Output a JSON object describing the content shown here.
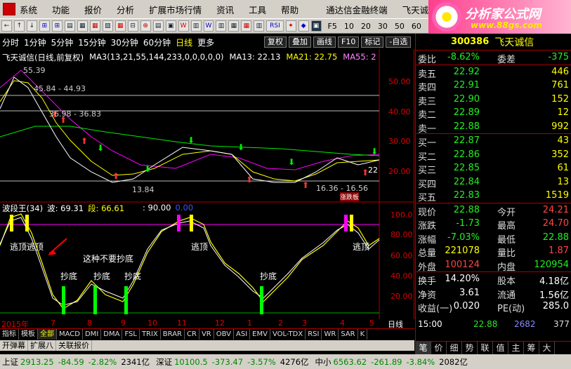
{
  "menu": {
    "items": [
      "系统",
      "功能",
      "报价",
      "分析",
      "扩展市场行情",
      "资讯",
      "工具",
      "帮助"
    ],
    "broker": "通达信金融终端",
    "stock_name": "飞天诚信",
    "trade_label": "行"
  },
  "logo": {
    "title": "分析家公式网",
    "url": "www.88gs.com"
  },
  "toolbar": {
    "buttons": [
      "←",
      "↑",
      "↓",
      "⊞",
      "⊞",
      "▤",
      "▦",
      "▦",
      "▧",
      "▦",
      "⊟",
      "⊕",
      "▤",
      "▣",
      "W",
      "▥",
      "W",
      "▥",
      "▦",
      "▦",
      "▥",
      "RSI",
      "✦",
      "◆",
      "▣"
    ],
    "nums": [
      "F5",
      "10",
      "20",
      "30",
      "50",
      "60"
    ]
  },
  "periods": [
    "分时",
    "1分钟",
    "5分钟",
    "15分钟",
    "30分钟",
    "60分钟",
    "日线",
    "更多"
  ],
  "active_period": "日线",
  "chart_toolbar": [
    "复权",
    "叠加",
    "画线",
    "F10",
    "标记",
    "-自选"
  ],
  "main_legend": {
    "title": "飞天诚信(日线,前复权)",
    "ma3": "MA3(13,21,55,144,233,0,0,0,0,0)",
    "ma13": "MA13: 22.13",
    "ma21": "MA21: 22.75",
    "ma55": "MA55: 2"
  },
  "price_labels": {
    "high": "55.39",
    "range1": "45.84 - 44.93",
    "range2": "36.98 - 36.83",
    "low1": "13.84",
    "low2": "16.36 - 16.56",
    "current": "22",
    "limit_tag": "涨跌板"
  },
  "y_axis_main": [
    "50.00",
    "40.00",
    "30.00",
    "20.00"
  ],
  "sub_legend": {
    "name": "波段王(34)",
    "wave": "波: 69.31",
    "segment": "段: 66.61",
    "mark1": ": 90.00",
    "mark2": "0.00"
  },
  "y_axis_sub": [
    "100.0",
    "80.00",
    "60.00",
    "40.00",
    "20.00"
  ],
  "annotations": {
    "top_left": "逃顶逃顶",
    "top_mid": "逃顶",
    "top_right": "逃顶",
    "bottom": "抄底",
    "note": "这种不要抄底"
  },
  "x_axis": [
    "2015年",
    "7",
    "8",
    "9",
    "10",
    "11",
    "12",
    "1",
    "2",
    "3",
    "4",
    "5"
  ],
  "x_axis_right": "日线",
  "indicator_tabs": [
    "指标",
    "模板",
    "全部",
    "MACD",
    "DMI",
    "DMA",
    "FSL",
    "TRIX",
    "BRAR",
    "CR",
    "VR",
    "OBV",
    "ASI",
    "EMV",
    "VOL-TDX",
    "RSI",
    "WR",
    "SAR",
    "K"
  ],
  "bottom_tools": [
    "开弹幕",
    "扩展八",
    "关联报价"
  ],
  "quote": {
    "code": "300386",
    "name": "飞天诚信",
    "weibi_label": "委比",
    "weibi": "-8.62%",
    "weicha_label": "委差",
    "weicha": "-375",
    "sell": [
      {
        "label": "卖五",
        "price": "22.92",
        "vol": "446"
      },
      {
        "label": "卖四",
        "price": "22.91",
        "vol": "761"
      },
      {
        "label": "卖三",
        "price": "22.90",
        "vol": "152"
      },
      {
        "label": "卖二",
        "price": "22.89",
        "vol": "12"
      },
      {
        "label": "卖一",
        "price": "22.88",
        "vol": "992"
      }
    ],
    "buy": [
      {
        "label": "买一",
        "price": "22.87",
        "vol": "43"
      },
      {
        "label": "买二",
        "price": "22.86",
        "vol": "352"
      },
      {
        "label": "买三",
        "price": "22.85",
        "vol": "61"
      },
      {
        "label": "买四",
        "price": "22.84",
        "vol": "13"
      },
      {
        "label": "买五",
        "price": "22.83",
        "vol": "1519"
      }
    ],
    "stats": [
      {
        "k1": "现价",
        "v1": "22.88",
        "c1": "red",
        "k2": "今开",
        "v2": "24.21",
        "c2": "red"
      },
      {
        "k1": "涨跌",
        "v1": "-1.73",
        "c1": "grn",
        "k2": "最高",
        "v2": "24.70",
        "c2": "red"
      },
      {
        "k1": "涨幅",
        "v1": "-7.03%",
        "c1": "grn",
        "k2": "最低",
        "v2": "22.88",
        "c2": "red"
      },
      {
        "k1": "总量",
        "v1": "221078",
        "c1": "yel",
        "k2": "量比",
        "v2": "1.87",
        "c2": "red"
      },
      {
        "k1": "外盘",
        "v1": "100124",
        "c1": "red",
        "k2": "内盘",
        "v2": "120954",
        "c2": "grn"
      }
    ],
    "stats2": [
      {
        "k1": "换手",
        "v1": "14.20%",
        "k2": "股本",
        "v2": "4.18亿"
      },
      {
        "k1": "净资",
        "v1": "3.61",
        "k2": "流通",
        "v2": "1.56亿"
      },
      {
        "k1": "收益(一)",
        "v1": "0.020",
        "k2": "PE(动)",
        "v2": "285.0"
      }
    ],
    "time": "15:00",
    "last_price": "22.88",
    "last_vol": "2682",
    "last_count": "377"
  },
  "side_tabs": [
    "笔",
    "价",
    "细",
    "势",
    "联",
    "值",
    "主",
    "筹",
    "大"
  ],
  "status": {
    "sh_label": "上证",
    "sh_index": "2913.25",
    "sh_chg": "-84.59",
    "sh_pct": "-2.82%",
    "sh_amt": "2341亿",
    "sz_label": "深证",
    "sz_index": "10100.5",
    "sz_chg": "-373.47",
    "sz_pct": "-3.57%",
    "sz_amt": "4276亿",
    "zx_label": "中小",
    "zx_index": "6563.62",
    "zx_chg": "-261.89",
    "zx_pct": "-3.84%",
    "zx_amt": "2082亿"
  },
  "colors": {
    "up": "#ff3333",
    "down": "#00cc00",
    "ma13": "#ffffff",
    "ma21": "#ffff00",
    "ma55": "#ff00ff",
    "ma144": "#00ff00",
    "axis": "#cc0000"
  }
}
